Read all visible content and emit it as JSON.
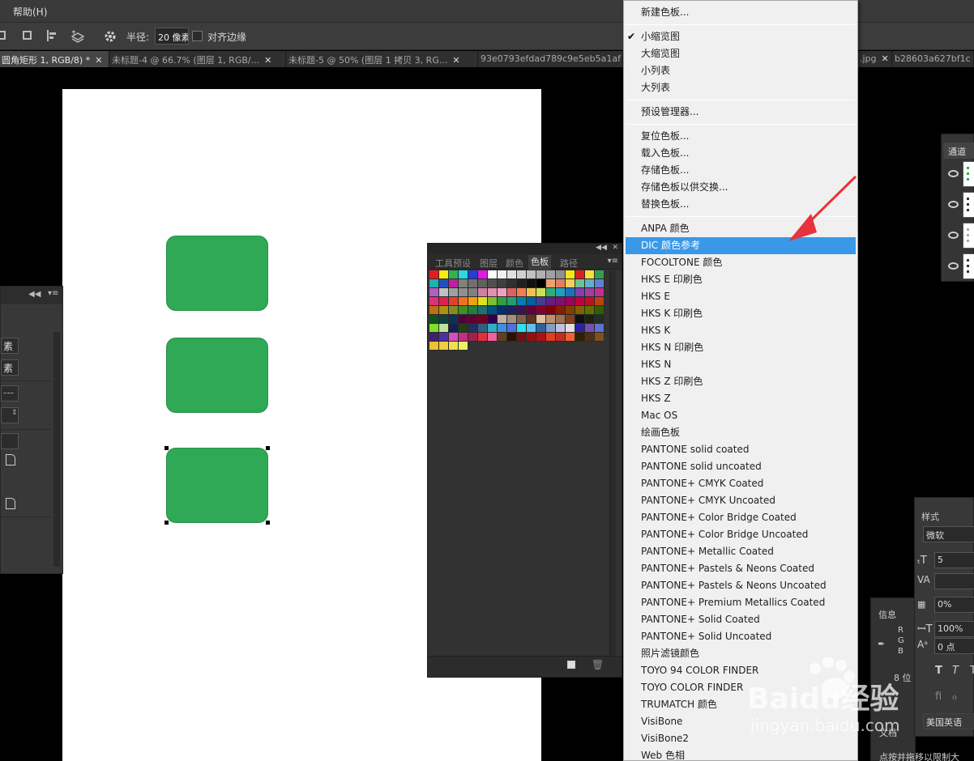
{
  "menubar": {
    "help": "帮助(H)"
  },
  "options": {
    "radius_label": "半径:",
    "radius_value": "20 像素",
    "align_edges_label": "对齐边缘"
  },
  "tabs": [
    {
      "label": "圆角矩形 1, RGB/8) *",
      "active": true
    },
    {
      "label": "未标题-4 @ 66.7% (图层 1, RGB/...",
      "active": false
    },
    {
      "label": "未标题-5 @ 50% (图层 1 拷贝 3, RG...",
      "active": false
    },
    {
      "label": "93e0793efdad789c9e5eb5a1af",
      "active": false
    },
    {
      "label": ".jpg",
      "active": false
    },
    {
      "label": "b28603a627bf1c",
      "active": false
    }
  ],
  "left_panel": {
    "row1": "素",
    "row2": "素"
  },
  "swatches_panel": {
    "tabs": [
      "工具预设",
      "图层",
      "颜色",
      "色板",
      "路径"
    ],
    "active_tab": "色板",
    "colors": [
      "#e51c1c",
      "#f6ea14",
      "#2fb34a",
      "#2cd7e0",
      "#1f3fd8",
      "#e01be0",
      "#ffffff",
      "#f0f0f0",
      "#e0e0e0",
      "#d0d0d0",
      "#c0c0c0",
      "#b0b0b0",
      "#a0a0a0",
      "#909090",
      "#f7e814",
      "#dc1f1f",
      "#f7e03a",
      "#30a050",
      "#20b0b0",
      "#2050c0",
      "#c020a0",
      "#808080",
      "#707070",
      "#606060",
      "#505050",
      "#404040",
      "#303030",
      "#202020",
      "#101010",
      "#000000",
      "#f0a070",
      "#e08060",
      "#f0d060",
      "#70c090",
      "#60b0d0",
      "#6080d0",
      "#b060c0",
      "#c0c0c0",
      "#a0a0a0",
      "#909090",
      "#808080",
      "#d080a0",
      "#e090b0",
      "#f0a0c0",
      "#e06060",
      "#f08050",
      "#f0c050",
      "#d0e050",
      "#30b070",
      "#20a0c0",
      "#2070c0",
      "#8040b0",
      "#a040a0",
      "#c03090",
      "#e0307a",
      "#e02050",
      "#e04030",
      "#f07020",
      "#f0a010",
      "#e0e020",
      "#80c030",
      "#30a040",
      "#20a070",
      "#0080b0",
      "#0060a0",
      "#404090",
      "#602080",
      "#801070",
      "#a00060",
      "#c00040",
      "#c01020",
      "#c04010",
      "#c07010",
      "#b09010",
      "#809020",
      "#409020",
      "#208040",
      "#207070",
      "#005080",
      "#003070",
      "#201f60",
      "#400f50",
      "#600040",
      "#800030",
      "#800010",
      "#802000",
      "#804000",
      "#806000",
      "#607000",
      "#306000",
      "#105020",
      "#104040",
      "#103050",
      "#500040",
      "#600030",
      "#700020",
      "#300050",
      "#c0b0a0",
      "#a09080",
      "#806050",
      "#603020",
      "#e0c0a0",
      "#c09070",
      "#a07050",
      "#804020",
      "#101010",
      "#202010",
      "#203020",
      "#80e030",
      "#c0e0a0",
      "#102050",
      "#204010",
      "#203060",
      "#306080",
      "#30b0c0",
      "#4090e0",
      "#5070e0",
      "#30e0f0",
      "#60c0f0",
      "#3060a0",
      "#80a0c0",
      "#c0c0e0",
      "#e0e0e0",
      "#3020a0",
      "#7050b0",
      "#6070d0",
      "#402070",
      "#5030a0",
      "#d050c0",
      "#c03080",
      "#a02050",
      "#e03040",
      "#f060a0",
      "#604020",
      "#301000",
      "#701010",
      "#901010",
      "#b01010",
      "#e04020",
      "#c03020",
      "#f06030",
      "#302000",
      "#503010",
      "#805020",
      "#f0c030",
      "#f0d040",
      "#f0e050",
      "#f0f060"
    ]
  },
  "dropdown_menu": {
    "items": [
      {
        "label": "新建色板...",
        "group": 0
      },
      {
        "label": "小缩览图",
        "group": 1,
        "checked": true
      },
      {
        "label": "大缩览图",
        "group": 1
      },
      {
        "label": "小列表",
        "group": 1
      },
      {
        "label": "大列表",
        "group": 1
      },
      {
        "label": "预设管理器...",
        "group": 2
      },
      {
        "label": "复位色板...",
        "group": 3
      },
      {
        "label": "载入色板...",
        "group": 3
      },
      {
        "label": "存储色板...",
        "group": 3
      },
      {
        "label": "存储色板以供交换...",
        "group": 3
      },
      {
        "label": "替换色板...",
        "group": 3
      },
      {
        "label": "ANPA 颜色",
        "group": 4
      },
      {
        "label": "DIC 颜色参考",
        "group": 4,
        "highlighted": true
      },
      {
        "label": "FOCOLTONE 颜色",
        "group": 4
      },
      {
        "label": "HKS E 印刷色",
        "group": 4
      },
      {
        "label": "HKS E",
        "group": 4
      },
      {
        "label": "HKS K 印刷色",
        "group": 4
      },
      {
        "label": "HKS K",
        "group": 4
      },
      {
        "label": "HKS N 印刷色",
        "group": 4
      },
      {
        "label": "HKS N",
        "group": 4
      },
      {
        "label": "HKS Z 印刷色",
        "group": 4
      },
      {
        "label": "HKS Z",
        "group": 4
      },
      {
        "label": "Mac OS",
        "group": 4
      },
      {
        "label": "绘画色板",
        "group": 4
      },
      {
        "label": "PANTONE solid coated",
        "group": 4
      },
      {
        "label": "PANTONE solid uncoated",
        "group": 4
      },
      {
        "label": "PANTONE+ CMYK Coated",
        "group": 4
      },
      {
        "label": "PANTONE+ CMYK Uncoated",
        "group": 4
      },
      {
        "label": "PANTONE+ Color Bridge Coated",
        "group": 4
      },
      {
        "label": "PANTONE+ Color Bridge Uncoated",
        "group": 4
      },
      {
        "label": "PANTONE+ Metallic Coated",
        "group": 4
      },
      {
        "label": "PANTONE+ Pastels & Neons Coated",
        "group": 4
      },
      {
        "label": "PANTONE+ Pastels & Neons Uncoated",
        "group": 4
      },
      {
        "label": "PANTONE+ Premium Metallics Coated",
        "group": 4
      },
      {
        "label": "PANTONE+ Solid Coated",
        "group": 4
      },
      {
        "label": "PANTONE+ Solid Uncoated",
        "group": 4
      },
      {
        "label": "照片滤镜颜色",
        "group": 4
      },
      {
        "label": "TOYO 94 COLOR FINDER",
        "group": 4
      },
      {
        "label": "TOYO COLOR FINDER",
        "group": 4
      },
      {
        "label": "TRUMATCH 颜色",
        "group": 4
      },
      {
        "label": "VisiBone",
        "group": 4
      },
      {
        "label": "VisiBone2",
        "group": 4
      },
      {
        "label": "Web 色相",
        "group": 4
      }
    ]
  },
  "right_panels": {
    "channels_tab": "通道",
    "styles_tab": "样式",
    "font_name": "微软",
    "size_value": "5",
    "tracking_value": "0%",
    "scale_value": "100%",
    "baseline_value": "0 点",
    "info_tab": "信息",
    "rgb_r": "R",
    "rgb_g": "G",
    "rgb_b": "B",
    "bit_depth": "8 位",
    "language": "美国英语",
    "hint_text": "点按并拖移以限制大",
    "doc_prefix": "文档"
  },
  "watermark": {
    "brand": "Baidu经验",
    "url": "jingyan.baidu.com"
  },
  "colors": {
    "shape_fill": "#2fa955",
    "menu_highlight": "#3a98e8",
    "arrow": "#e8323c"
  }
}
